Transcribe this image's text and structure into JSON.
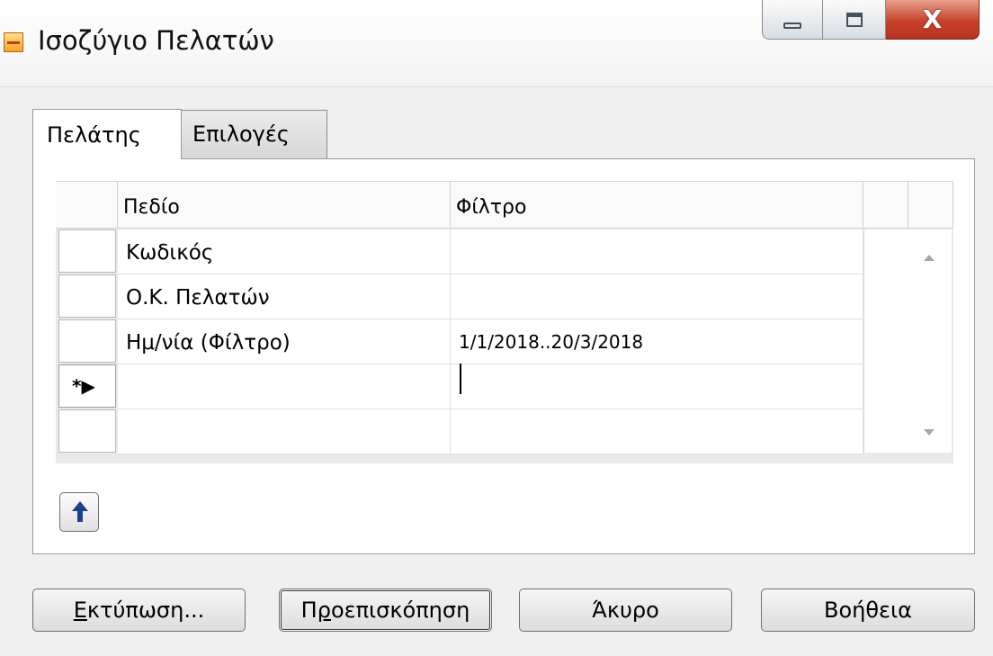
{
  "window": {
    "title": "Ισοζύγιο Πελατών",
    "close_glyph": "X"
  },
  "tabs": [
    {
      "label": "Πελάτης",
      "active": true
    },
    {
      "label": "Επιλογές",
      "active": false
    }
  ],
  "grid": {
    "columns": [
      "Πεδίο",
      "Φίλτρο"
    ],
    "rows": [
      {
        "field": "Κωδικός",
        "filter": ""
      },
      {
        "field": "Ο.Κ. Πελατών",
        "filter": ""
      },
      {
        "field": "Ημ/νία (Φίλτρο)",
        "filter": "1/1/2018..20/3/2018"
      },
      {
        "field": "",
        "filter": "",
        "marker": "*▶"
      },
      {
        "field": "",
        "filter": ""
      }
    ]
  },
  "buttons": {
    "print": {
      "mnemonic": "Ε",
      "rest": "κτύπωση..."
    },
    "preview": {
      "before": "Π",
      "mnemonic": "ρ",
      "rest": "οεπισκόπηση"
    },
    "cancel": "Άκυρο",
    "help": "Βοήθεια"
  },
  "icons": [
    "app-icon",
    "minimize-icon",
    "maximize-icon",
    "close-icon",
    "scroll-up-icon",
    "scroll-down-icon",
    "move-up-arrow-icon",
    "new-row-icon"
  ]
}
